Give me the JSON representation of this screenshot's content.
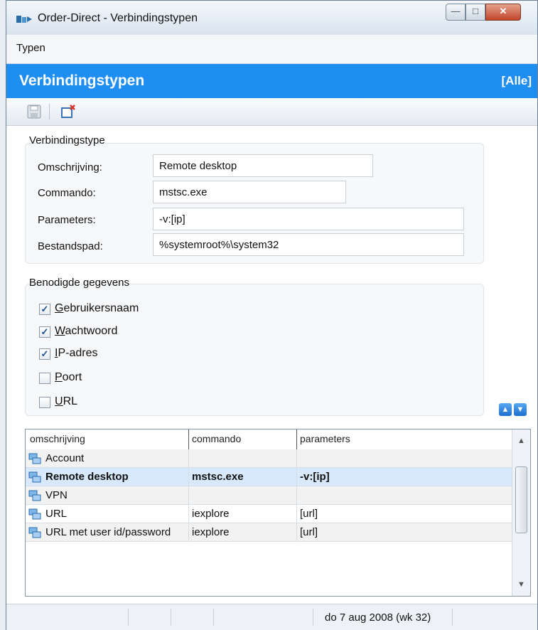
{
  "window": {
    "title": "Order-Direct - Verbindingstypen"
  },
  "menu": {
    "items": [
      "Typen"
    ]
  },
  "header": {
    "title": "Verbindingstypen",
    "filter": "[Alle]"
  },
  "form": {
    "group_title": "Verbindingstype",
    "fields": [
      {
        "label": "Omschrijving:",
        "value": "Remote desktop"
      },
      {
        "label": "Commando:",
        "value": "mstsc.exe"
      },
      {
        "label": "Parameters:",
        "value": "-v:[ip]"
      },
      {
        "label": "Bestandspad:",
        "value": "%systemroot%\\system32"
      }
    ]
  },
  "requirements": {
    "group_title": "Benodigde gegevens",
    "items": [
      {
        "label": "Gebruikersnaam",
        "checked": true
      },
      {
        "label": "Wachtwoord",
        "checked": true
      },
      {
        "label": "IP-adres",
        "checked": true
      },
      {
        "label": "Poort",
        "checked": false
      },
      {
        "label": "URL",
        "checked": false
      }
    ]
  },
  "grid": {
    "columns": [
      "omschrijving",
      "commando",
      "parameters"
    ],
    "rows": [
      {
        "omschrijving": "Account",
        "commando": "",
        "parameters": ""
      },
      {
        "omschrijving": "Remote desktop",
        "commando": "mstsc.exe",
        "parameters": "-v:[ip]",
        "selected": true
      },
      {
        "omschrijving": "VPN",
        "commando": "",
        "parameters": ""
      },
      {
        "omschrijving": "URL",
        "commando": "iexplore",
        "parameters": "[url]"
      },
      {
        "omschrijving": "URL met user id/password",
        "commando": "iexplore",
        "parameters": "[url]"
      }
    ]
  },
  "status": {
    "date": "do 7 aug 2008 (wk 32)"
  },
  "colors": {
    "header_bg": "#1e8ef2",
    "selected_row": "#d8e9fb",
    "checkbox_mark": "#1d4f98"
  },
  "icons": [
    "app-icon",
    "save-icon",
    "new-icon",
    "chevron-up-icon",
    "chevron-down-icon",
    "connection-icon"
  ]
}
